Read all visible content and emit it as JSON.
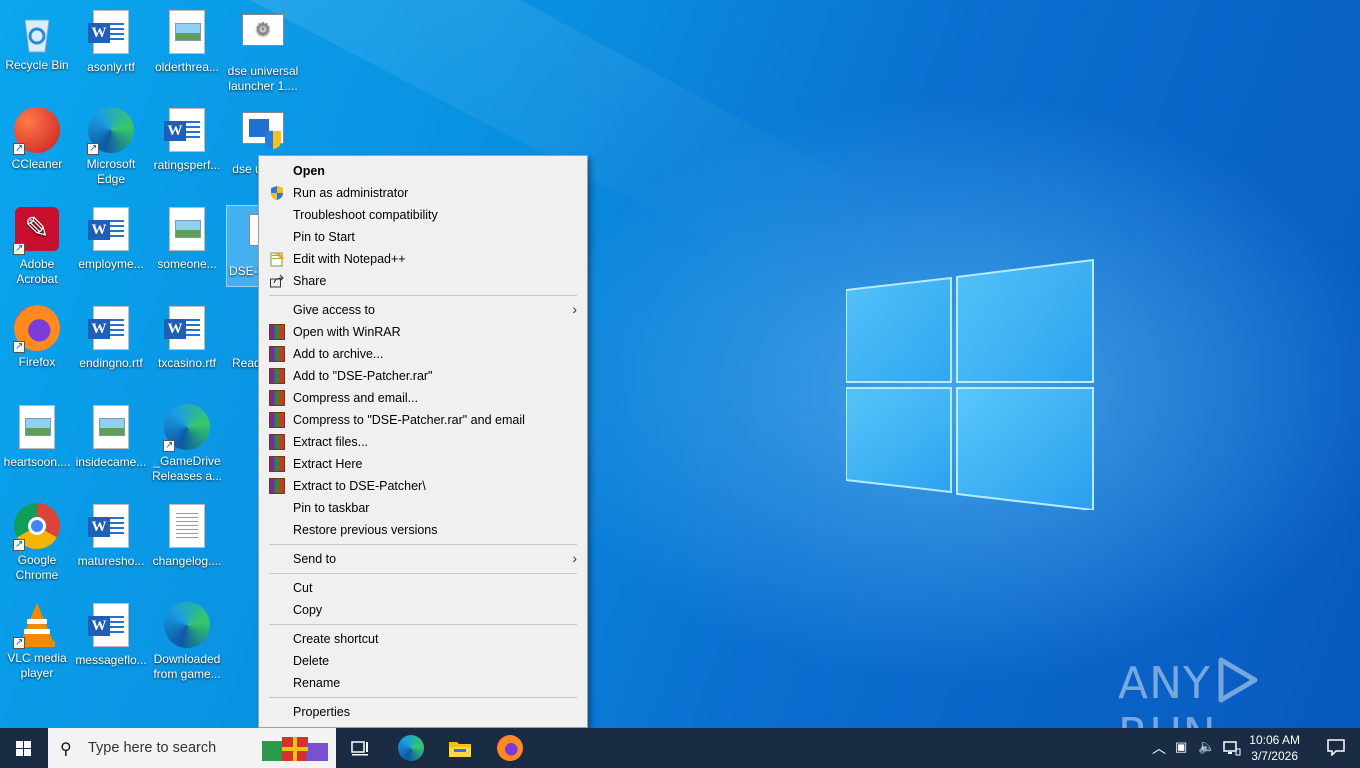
{
  "desktop": {
    "icons": [
      {
        "label": "Recycle Bin"
      },
      {
        "label": "asonly.rtf"
      },
      {
        "label": "olderthrea..."
      },
      {
        "label": "dse universal launcher 1...."
      },
      {
        "label": "CCleaner"
      },
      {
        "label": "Microsoft Edge"
      },
      {
        "label": "ratingsperf..."
      },
      {
        "label": "dse u launc"
      },
      {
        "label": "Adobe Acrobat"
      },
      {
        "label": "employme..."
      },
      {
        "label": "someone..."
      },
      {
        "label": "DSE-P e"
      },
      {
        "label": "Firefox"
      },
      {
        "label": "endingno.rtf"
      },
      {
        "label": "txcasino.rtf"
      },
      {
        "label": "Read"
      },
      {
        "label": "heartsoon...."
      },
      {
        "label": "insidecame..."
      },
      {
        "label": "_GameDrive Releases a..."
      },
      {
        "label": "Google Chrome"
      },
      {
        "label": "maturesho..."
      },
      {
        "label": "changelog...."
      },
      {
        "label": "VLC media player"
      },
      {
        "label": "messageflo..."
      },
      {
        "label": "Downloaded from game..."
      }
    ]
  },
  "context_menu": {
    "items": [
      {
        "label": "Open",
        "icon": "",
        "bold": true
      },
      {
        "label": "Run as administrator",
        "icon": "uac-shield-icon"
      },
      {
        "label": "Troubleshoot compatibility",
        "icon": ""
      },
      {
        "label": "Pin to Start",
        "icon": ""
      },
      {
        "label": "Edit with Notepad++",
        "icon": "notepadpp-icon"
      },
      {
        "label": "Share",
        "icon": "share-icon"
      },
      {
        "label": "Give access to",
        "icon": "",
        "submenu": true
      },
      {
        "label": "Open with WinRAR",
        "icon": "winrar-icon"
      },
      {
        "label": "Add to archive...",
        "icon": "winrar-icon"
      },
      {
        "label": "Add to \"DSE-Patcher.rar\"",
        "icon": "winrar-icon"
      },
      {
        "label": "Compress and email...",
        "icon": "winrar-icon"
      },
      {
        "label": "Compress to \"DSE-Patcher.rar\" and email",
        "icon": "winrar-icon"
      },
      {
        "label": "Extract files...",
        "icon": "winrar-icon"
      },
      {
        "label": "Extract Here",
        "icon": "winrar-icon"
      },
      {
        "label": "Extract to DSE-Patcher\\",
        "icon": "winrar-icon"
      },
      {
        "label": "Pin to taskbar",
        "icon": ""
      },
      {
        "label": "Restore previous versions",
        "icon": ""
      },
      {
        "label": "Send to",
        "icon": "",
        "submenu": true
      },
      {
        "label": "Cut",
        "icon": ""
      },
      {
        "label": "Copy",
        "icon": ""
      },
      {
        "label": "Create shortcut",
        "icon": ""
      },
      {
        "label": "Delete",
        "icon": ""
      },
      {
        "label": "Rename",
        "icon": ""
      },
      {
        "label": "Properties",
        "icon": ""
      }
    ]
  },
  "taskbar": {
    "search_placeholder": "Type here to search",
    "pinned": [
      "task-view-icon",
      "edge-icon",
      "file-explorer-icon",
      "firefox-icon"
    ],
    "clock": {
      "time": "10:06 AM",
      "date": "3/7/2026"
    }
  },
  "watermark": {
    "text_left": "ANY",
    "text_right": "RUN"
  },
  "colors": {
    "menu_bg": "#f0f0f0",
    "taskbar_bg": "#1a2c44",
    "desktop_accent": "#0a8fe0"
  }
}
